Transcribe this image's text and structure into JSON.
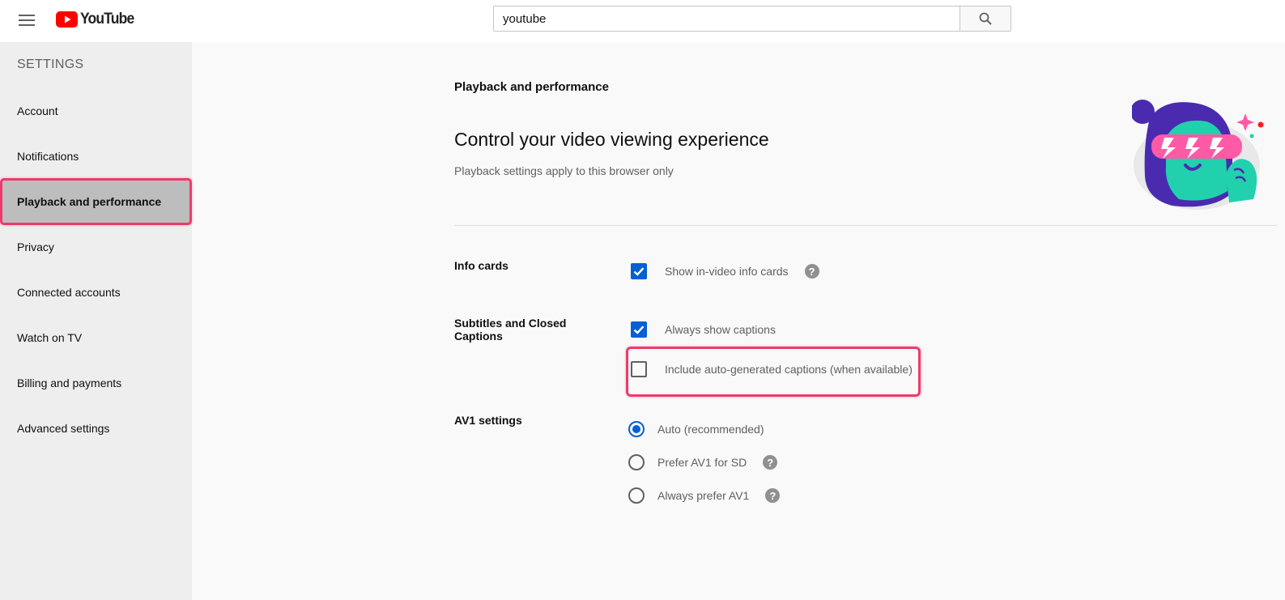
{
  "header": {
    "logo_text": "YouTube",
    "search_value": "youtube",
    "colors": {
      "logo_red": "#ff0000"
    }
  },
  "sidebar": {
    "title": "SETTINGS",
    "items": [
      {
        "label": "Account"
      },
      {
        "label": "Notifications"
      },
      {
        "label": "Playback and performance",
        "active": true
      },
      {
        "label": "Privacy"
      },
      {
        "label": "Connected accounts"
      },
      {
        "label": "Watch on TV"
      },
      {
        "label": "Billing and payments"
      },
      {
        "label": "Advanced settings"
      }
    ]
  },
  "main": {
    "section_heading": "Playback and performance",
    "title": "Control your video viewing experience",
    "subtitle": "Playback settings apply to this browser only",
    "groups": {
      "info_cards": {
        "label": "Info cards",
        "options": [
          {
            "label": "Show in-video info cards",
            "checked": true
          }
        ]
      },
      "captions": {
        "label": "Subtitles and Closed Captions",
        "options": [
          {
            "label": "Always show captions",
            "checked": true
          },
          {
            "label": "Include auto-generated captions (when available)",
            "checked": false
          }
        ]
      },
      "av1": {
        "label": "AV1 settings",
        "options": [
          {
            "label": "Auto (recommended)",
            "selected": true
          },
          {
            "label": "Prefer AV1 for SD",
            "selected": false
          },
          {
            "label": "Always prefer AV1",
            "selected": false
          }
        ]
      }
    },
    "help_glyph": "?"
  },
  "colors": {
    "accent_blue": "#065fd4",
    "highlight": "#ee3a6a",
    "sidebar_bg": "#eeeeee",
    "active_item_bg": "#bdbdbd"
  }
}
